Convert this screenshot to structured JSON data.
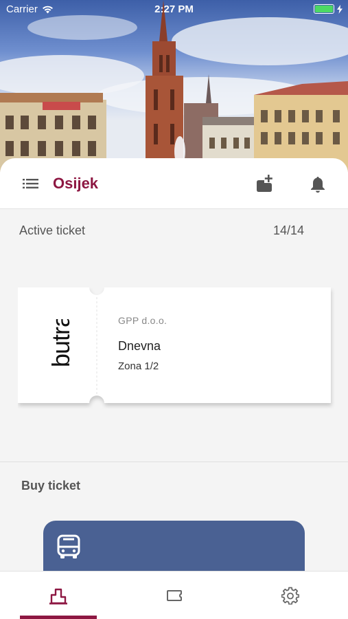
{
  "status_bar": {
    "carrier": "Carrier",
    "time": "2:27 PM"
  },
  "header": {
    "city": "Osijek"
  },
  "active_ticket": {
    "label": "Active ticket",
    "count": "14/14",
    "logo_text": "butra",
    "company": "GPP d.o.o.",
    "name": "Dnevna",
    "zone": "Zona 1/2"
  },
  "buy_ticket": {
    "label": "Buy ticket"
  },
  "colors": {
    "brand": "#8d1742",
    "buy_card": "#4a6193",
    "battery": "#4cd964"
  },
  "tabs": [
    {
      "icon": "city-icon",
      "active": true
    },
    {
      "icon": "ticket-icon",
      "active": false
    },
    {
      "icon": "settings-gear-icon",
      "active": false
    }
  ]
}
